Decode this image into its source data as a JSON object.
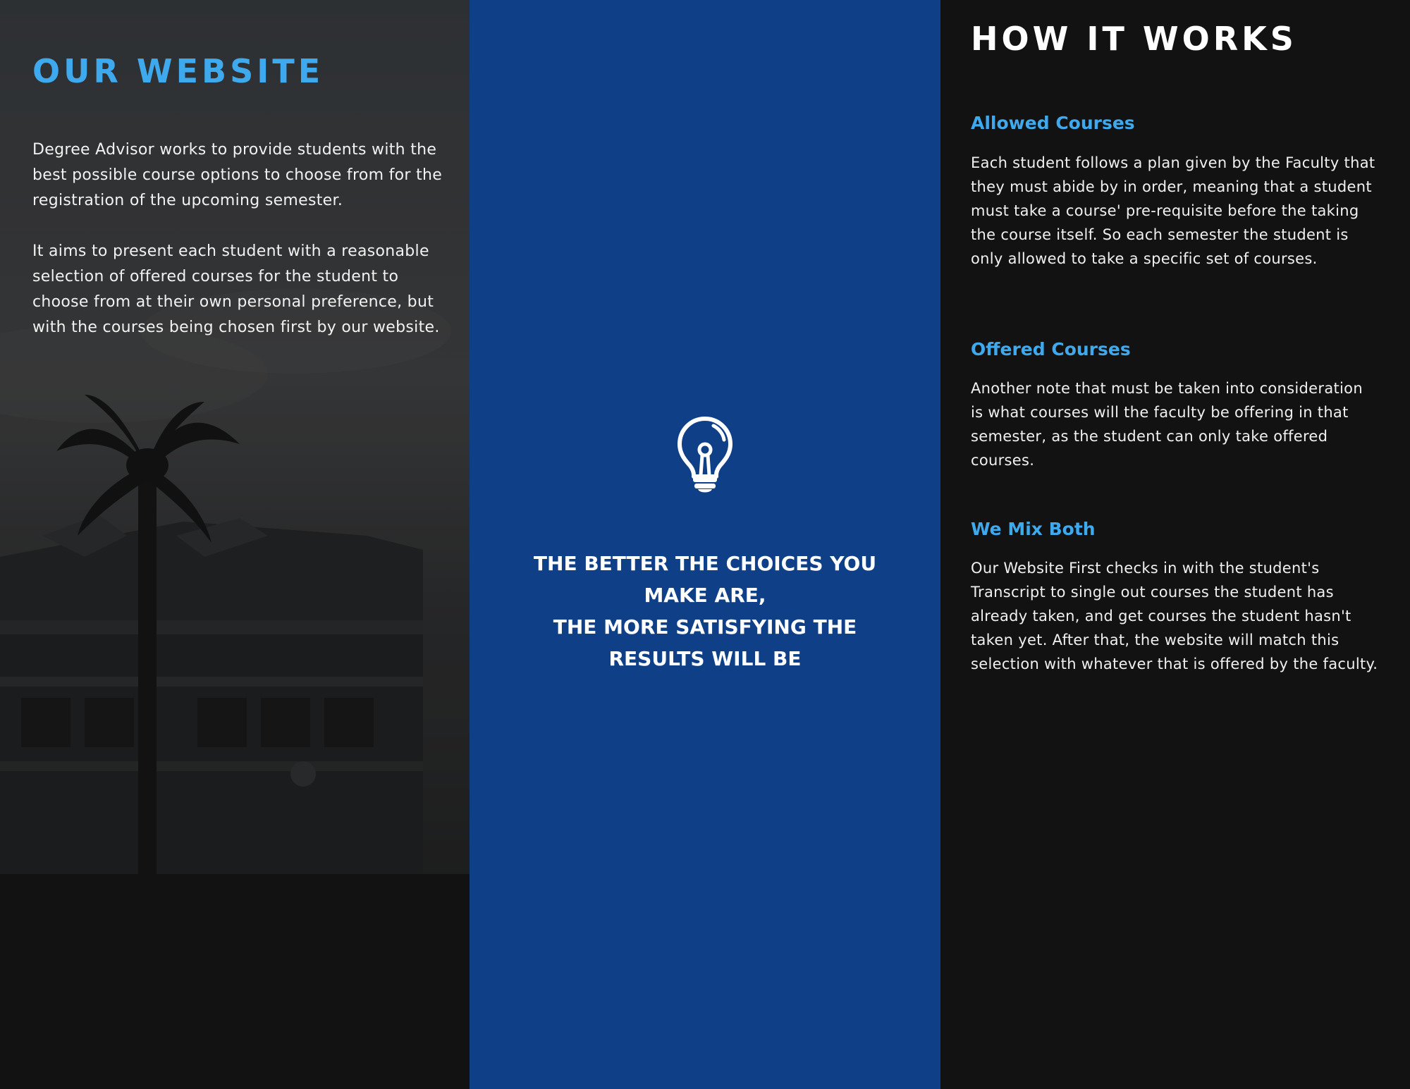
{
  "left": {
    "title": "OUR WEBSITE",
    "paragraph1": "Degree Advisor works to provide students with the best possible course options to choose from for the registration of the upcoming semester.",
    "paragraph2": "It aims to present each student with a reasonable selection of offered courses for the student to choose from at their own personal preference, but with the courses being chosen first by our website."
  },
  "middle": {
    "icon": "lightbulb-icon",
    "quote_line1": "THE BETTER THE CHOICES YOU MAKE ARE,",
    "quote_line2": "THE MORE SATISFYING THE RESULTS WILL BE"
  },
  "right": {
    "title": "HOW IT WORKS",
    "sections": [
      {
        "heading": "Allowed Courses",
        "text": "Each student follows a plan given by the Faculty that they must abide by in order, meaning that a student must take a course' pre-requisite before the taking the course itself. So each semester the student is only allowed to take a specific set of courses."
      },
      {
        "heading": "Offered Courses",
        "text": "Another note that must be taken into consideration is what courses will the faculty be offering in that semester, as the student can only take offered courses."
      },
      {
        "heading": "We Mix Both",
        "text": "Our Website First checks in with the student's Transcript to single out courses the student has already taken, and get courses the student hasn't taken yet. After that, the website will match this selection with whatever that is offered by the faculty."
      }
    ]
  },
  "colors": {
    "accent": "#3fa9ee",
    "middle_panel": "#0e3f87",
    "right_panel": "#121212",
    "text": "#f2f2f2"
  }
}
